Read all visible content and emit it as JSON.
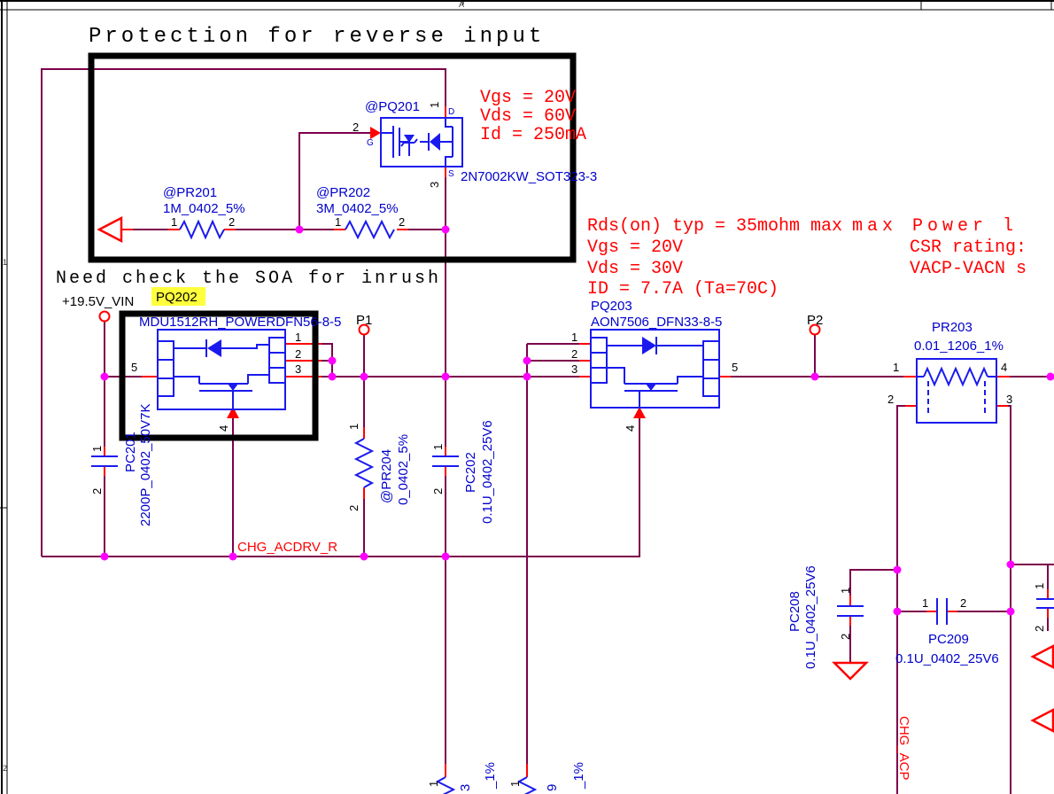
{
  "sheet": {
    "zone_col_a": "A",
    "zone_row_1": "1",
    "zone_row_2": "2"
  },
  "notes": {
    "title": "Protection for reverse input",
    "soa": "Need check the SOA for inrush"
  },
  "annotations": {
    "pq201_specs": {
      "l1": "Vgs = 20V",
      "l2": "Vds = 60V",
      "l3": "Id = 250mA"
    },
    "pq203_specs": {
      "l1a": "Rds(on) typ = 35mohm max",
      "l1b": "max Power l",
      "l2a": "Vgs = 20V",
      "l2b": "CSR rating:",
      "l3a": "Vds = 30V",
      "l3b": "VACP-VACN s",
      "l4": "ID = 7.7A (Ta=70C)"
    }
  },
  "nets": {
    "vin": "+19.5V_VIN",
    "acdrv": "CHG_ACDRV_R",
    "acp": "CHG_ACP"
  },
  "testpoints": {
    "p1": "P1",
    "p2": "P2"
  },
  "components": {
    "pq201": {
      "ref": "@PQ201",
      "part": "2N7002KW_SOT323-3",
      "pin1": "1",
      "pin2": "2",
      "pin3": "3",
      "g": "G",
      "d": "D",
      "s": "S"
    },
    "pr201": {
      "ref": "@PR201",
      "value": "1M_0402_5%",
      "pin1": "1",
      "pin2": "2"
    },
    "pr202": {
      "ref": "@PR202",
      "value": "3M_0402_5%",
      "pin1": "1",
      "pin2": "2"
    },
    "pq202": {
      "ref": "PQ202",
      "part": "MDU1512RH_POWERDFN56-8-5",
      "pin1": "1",
      "pin2": "2",
      "pin3": "3",
      "pin4": "4",
      "pin5": "5"
    },
    "pq203": {
      "ref": "PQ203",
      "part": "AON7506_DFN33-8-5",
      "pin1": "1",
      "pin2": "2",
      "pin3": "3",
      "pin4": "4",
      "pin5": "5"
    },
    "pc201": {
      "ref": "PC201",
      "value": "2200P_0402_50V7K",
      "pin1": "1",
      "pin2": "2"
    },
    "pr204": {
      "ref": "@PR204",
      "value": "0_0402_5%",
      "pin1": "1",
      "pin2": "2"
    },
    "pc202": {
      "ref": "PC202",
      "value": "0.1U_0402_25V6",
      "pin1": "1",
      "pin2": "2"
    },
    "pr203": {
      "ref": "PR203",
      "value": "0.01_1206_1%",
      "pin1": "1",
      "pin2": "2",
      "pin3": "3",
      "pin4": "4"
    },
    "pc208": {
      "ref": "PC208",
      "value": "0.1U_0402_25V6",
      "pin1": "1",
      "pin2": "2"
    },
    "pc209": {
      "ref": "PC209",
      "value": "0.1U_0402_25V6",
      "pin1": "1",
      "pin2": "2"
    },
    "partial_res_left": {
      "pin1": "1",
      "ref_fragment": "3",
      "value_fragment": "_1%"
    },
    "partial_res_right": {
      "pin1": "1",
      "ref_fragment": "9",
      "value_fragment": "_1%"
    },
    "partial_cap_right": {
      "pin1": "1",
      "pin2": "2"
    }
  },
  "colors": {
    "wire": "#7D004B",
    "symbol_blue": "#1A1AEF",
    "label_blue": "#0000CC",
    "red": "#FF0000",
    "junction": "#FF00FF",
    "highlight": "#FFFF3C"
  }
}
